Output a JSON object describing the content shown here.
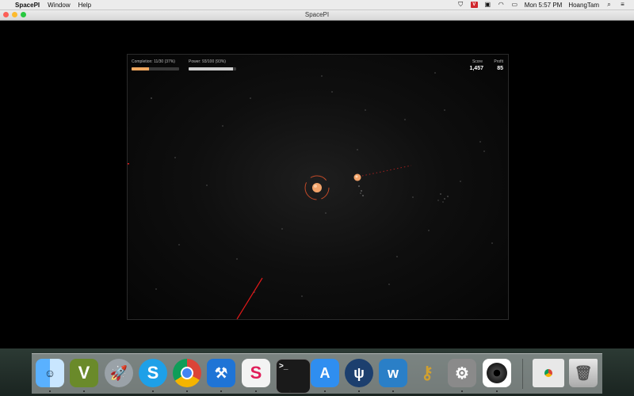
{
  "menubar": {
    "app_name": "SpacePI",
    "menus": [
      "Window",
      "Help"
    ],
    "clock": "Mon 5:57 PM",
    "user": "HoangTam"
  },
  "window": {
    "title": "SpacePI"
  },
  "hud": {
    "completion_label": "Completion: 11/30 (37%)",
    "completion_fraction": 0.37,
    "power_label": "Power: 93/100 (93%)",
    "power_fraction": 0.93,
    "score_header": "Score",
    "score_value": "1,457",
    "profit_header": "Profit",
    "profit_value": "85"
  },
  "colors": {
    "completion_bar": "#f0a860",
    "power_bar": "#cfcfcf",
    "planet": "#f2a36a",
    "orbit_ring": "#e0522a",
    "laser": "#e01818"
  },
  "dock": {
    "apps": [
      "finder-icon",
      "vim-icon",
      "launchpad-icon",
      "skype-icon",
      "chrome-icon",
      "xcode-icon",
      "slack-icon",
      "terminal-icon",
      "app-store-icon",
      "sourcetree-icon",
      "wunderlist-icon",
      "keychain-icon",
      "system-preferences-icon",
      "dvd-player-icon",
      "chrome-window-icon",
      "trash-icon"
    ]
  }
}
